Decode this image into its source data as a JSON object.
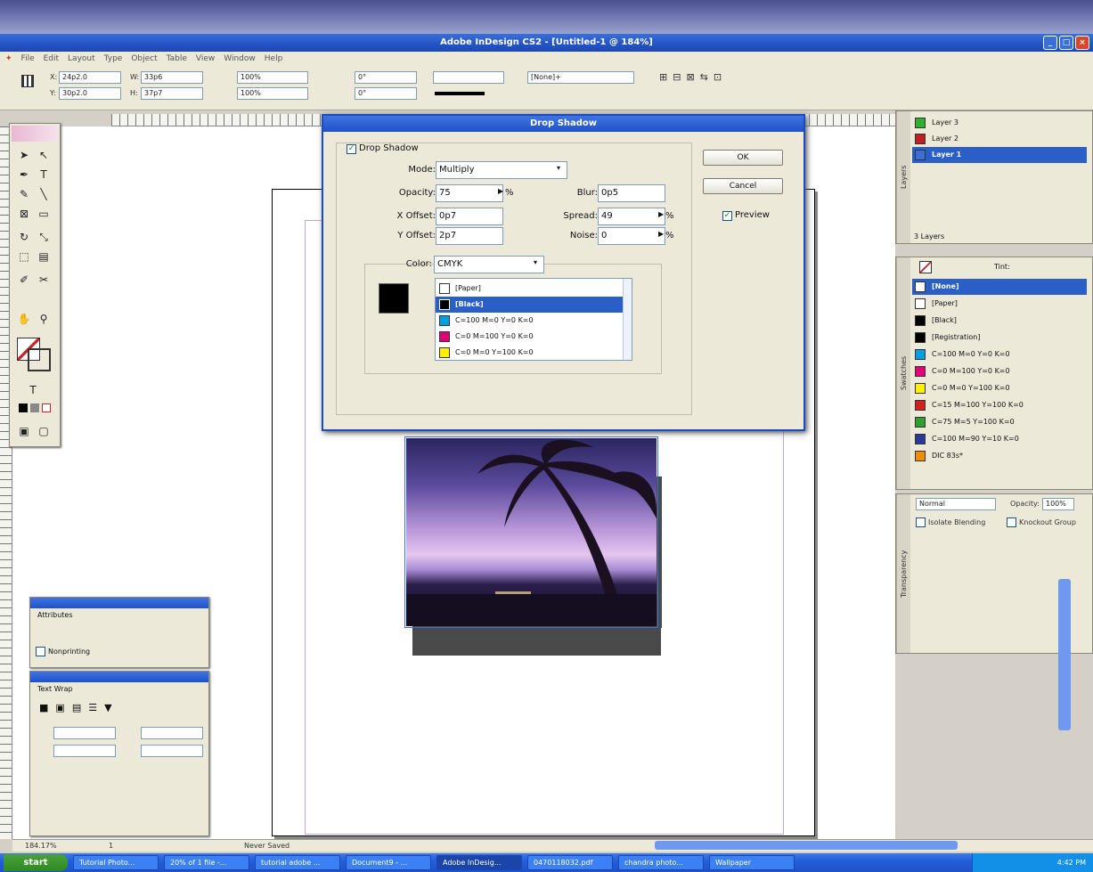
{
  "app": {
    "title": "Adobe InDesign CS2 - [Untitled-1 @ 184%]",
    "zoom": "184.17%",
    "page": "1",
    "status": "Never Saved"
  },
  "menus": [
    "File",
    "Edit",
    "Layout",
    "Type",
    "Object",
    "Table",
    "View",
    "Window",
    "Help"
  ],
  "control": {
    "x": "24p2.0",
    "y": "30p2.0",
    "w": "33p6",
    "h": "37p7",
    "scale_x": "100%",
    "scale_y": "100%",
    "rotate": "0°",
    "shear": "0°",
    "style": "[None]+"
  },
  "dialog": {
    "title": "Drop Shadow",
    "enable_label": "Drop Shadow",
    "mode_label": "Mode:",
    "mode_value": "Multiply",
    "opacity_label": "Opacity:",
    "opacity_value": "75",
    "percent": "%",
    "blur_label": "Blur:",
    "blur_value": "0p5",
    "xoffset_label": "X Offset:",
    "xoffset_value": "0p7",
    "spread_label": "Spread:",
    "spread_value": "49",
    "yoffset_label": "Y Offset:",
    "yoffset_value": "2p7",
    "noise_label": "Noise:",
    "noise_value": "0",
    "color_label": "Color:",
    "color_value": "CMYK",
    "ok": "OK",
    "cancel": "Cancel",
    "preview": "Preview",
    "swatches": [
      {
        "name": "[Paper]",
        "color": "#ffffff"
      },
      {
        "name": "[Black]",
        "color": "#000000"
      },
      {
        "name": "C=100 M=0 Y=0 K=0",
        "color": "#00a0e0"
      },
      {
        "name": "C=0 M=100 Y=0 K=0",
        "color": "#e0007a"
      },
      {
        "name": "C=0 M=0 Y=100 K=0",
        "color": "#fff000"
      }
    ]
  },
  "layers": {
    "items": [
      {
        "name": "Layer 3",
        "color": "#2fb02f"
      },
      {
        "name": "Layer 2",
        "color": "#c02020"
      },
      {
        "name": "Layer 1",
        "color": "#3a6fd8"
      }
    ],
    "count": "3 Layers",
    "tab": "Layers"
  },
  "swatches_panel": {
    "tint_label": "Tint:",
    "tab": "Swatches",
    "items": [
      {
        "name": "[None]",
        "color": "#ffffff"
      },
      {
        "name": "[Paper]",
        "color": "#ffffff"
      },
      {
        "name": "[Black]",
        "color": "#000000"
      },
      {
        "name": "[Registration]",
        "color": "#000000"
      },
      {
        "name": "C=100 M=0 Y=0 K=0",
        "color": "#00a0e0"
      },
      {
        "name": "C=0 M=100 Y=0 K=0",
        "color": "#e0007a"
      },
      {
        "name": "C=0 M=0 Y=100 K=0",
        "color": "#fff000"
      },
      {
        "name": "C=15 M=100 Y=100 K=0",
        "color": "#d02020"
      },
      {
        "name": "C=75 M=5 Y=100 K=0",
        "color": "#2fa030"
      },
      {
        "name": "C=100 M=90 Y=10 K=0",
        "color": "#2a3a9a"
      },
      {
        "name": "DIC 83s*",
        "color": "#f28c00"
      }
    ]
  },
  "transparency": {
    "mode": "Normal",
    "opacity_label": "Opacity:",
    "opacity": "100%",
    "isolate": "Isolate Blending",
    "knockout": "Knockout Group",
    "tab": "Transparency"
  },
  "attributes": {
    "title": "Attributes",
    "nonprinting": "Nonprinting"
  },
  "textwrap": {
    "title": "Text Wrap"
  },
  "taskbar": {
    "start": "start",
    "tasks": [
      "Tutorial Photo...",
      "20% of 1 file -...",
      "tutorial adobe ...",
      "Document9 - ...",
      "Adobe InDesig...",
      "0470118032.pdf",
      "chandra photo...",
      "Wallpaper"
    ],
    "time": "4:42 PM"
  }
}
